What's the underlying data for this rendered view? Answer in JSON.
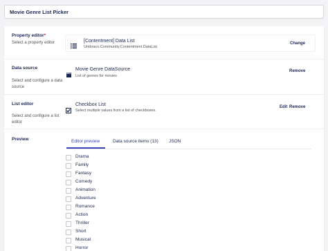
{
  "name_field": {
    "value": "Movie Genre List Picker"
  },
  "property_editor": {
    "label": "Property editor",
    "required_mark": "*",
    "description": "Select a property editor",
    "editor": {
      "icon": "list-icon",
      "name": "[Contentment] Data List",
      "alias": "Umbraco.Community.Contentment.DataList",
      "action": "Change"
    }
  },
  "data_source": {
    "label": "Data source",
    "description": "Select and configure a data source",
    "item": {
      "icon": "clapperboard-icon",
      "name": "Movie Genre DataSource",
      "description": "List of genres for movies",
      "remove": "Remove"
    }
  },
  "list_editor": {
    "label": "List editor",
    "description": "Select and configure a list editor",
    "item": {
      "icon": "checkbox-icon",
      "name": "Checkbox List",
      "description": "Select multiple values from a list of checkboxes.",
      "edit": "Edit",
      "remove": "Remove"
    }
  },
  "preview": {
    "label": "Preview",
    "tabs": [
      "Editor preview",
      "Data source items (13)",
      "JSON"
    ],
    "active_tab": "Editor preview",
    "accent_color": "#3544b1",
    "items": [
      "Drama",
      "Family",
      "Fantasy",
      "Comedy",
      "Animation",
      "Adventure",
      "Romance",
      "Action",
      "Thriller",
      "Short",
      "Musical",
      "Horror"
    ]
  }
}
